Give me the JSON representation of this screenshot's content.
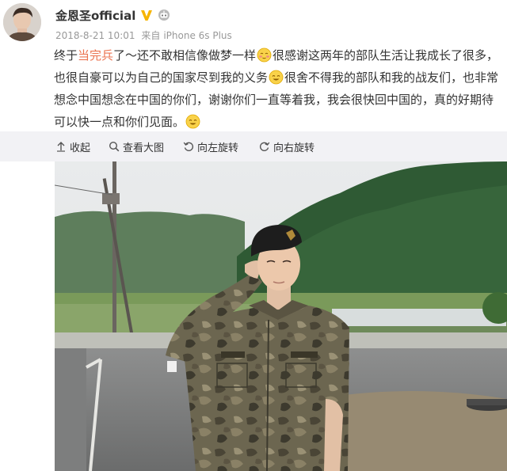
{
  "post": {
    "author": "金恩圣official",
    "date": "2018-8-21 10:01",
    "source_prefix": "来自",
    "source": "iPhone 6s Plus",
    "text": {
      "part1": "终于",
      "mention": "当完兵",
      "part2": "了～还不敢相信像做梦一样",
      "part3": "很感谢这两年的部队生活让我成长了很多，也很自豪可以为自己的国家尽到我的义务",
      "part4": "很舍不得我的部队和我的战友们，也非常想念中国想念在中国的你们，谢谢你们一直等着我，我会很快回中国的，真的好期待可以快一点和你们见面。"
    }
  },
  "toolbar": {
    "collapse": "收起",
    "view_large": "查看大图",
    "rotate_left": "向左旋转",
    "rotate_right": "向右旋转"
  },
  "icons": {
    "vip": "vip-v-icon",
    "robot": "robot-icon",
    "emoji_shy": "shy-emoji-icon",
    "emoji_smile": "smile-emoji-icon",
    "collapse": "collapse-arrow-icon",
    "search": "search-icon",
    "rotate_left": "rotate-left-icon",
    "rotate_right": "rotate-right-icon"
  },
  "colors": {
    "mention": "#eb7350",
    "vip_badge": "#f6b400",
    "toolbar_bg": "#f2f2f5",
    "meta_text": "#999999"
  }
}
